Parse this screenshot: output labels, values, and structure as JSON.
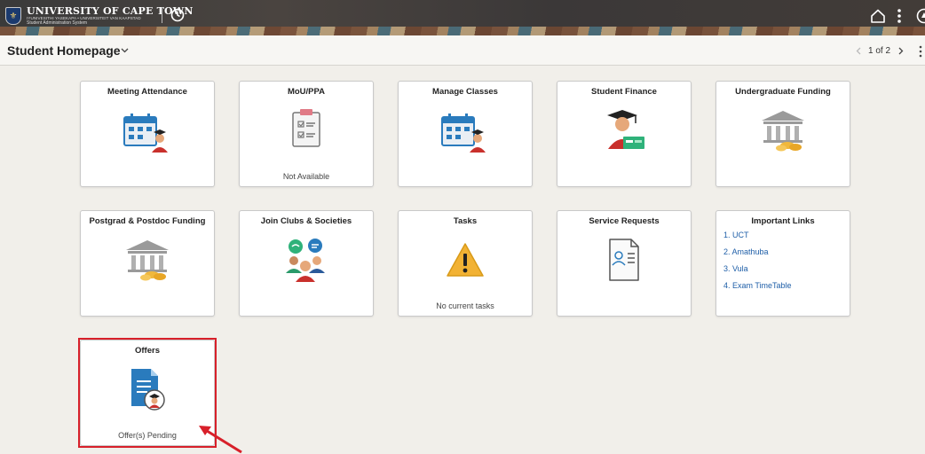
{
  "header": {
    "university_name": "UNIVERSITY OF CAPE TOWN",
    "university_subtitle": "IYUNIVESITHI YASEKAPA • UNIVERSITEIT VAN KAAPSTAD",
    "system_name": "Student Administration System",
    "icons": [
      "history-icon",
      "home-icon",
      "more-icon",
      "navbar-icon"
    ]
  },
  "page": {
    "title": "Student Homepage",
    "page_count": "1 of 2"
  },
  "tiles": [
    {
      "title": "Meeting Attendance",
      "icon": "calendar-person-icon",
      "footer": ""
    },
    {
      "title": "MoU/PPA",
      "icon": "checklist-icon",
      "footer": "Not Available"
    },
    {
      "title": "Manage Classes",
      "icon": "calendar-person-icon",
      "footer": ""
    },
    {
      "title": "Student Finance",
      "icon": "graduate-finance-icon",
      "footer": ""
    },
    {
      "title": "Undergraduate Funding",
      "icon": "bank-coins-icon",
      "footer": ""
    },
    {
      "title": "Postgrad & Postdoc Funding",
      "icon": "bank-coins-icon",
      "footer": ""
    },
    {
      "title": "Join Clubs & Societies",
      "icon": "people-chat-icon",
      "footer": ""
    },
    {
      "title": "Tasks",
      "icon": "warning-icon",
      "footer": "No current tasks"
    },
    {
      "title": "Service Requests",
      "icon": "document-person-icon",
      "footer": ""
    },
    {
      "title": "Important Links",
      "icon": "",
      "footer": "",
      "links": [
        "1. UCT",
        "2. Amathuba",
        "3. Vula",
        "4. Exam TimeTable"
      ]
    },
    {
      "title": "Offers",
      "icon": "offer-document-icon",
      "footer": "Offer(s) Pending"
    }
  ],
  "colors": {
    "highlight": "#d8202a",
    "link": "#1f5fa8",
    "header_bg": "#3a3a3a"
  }
}
